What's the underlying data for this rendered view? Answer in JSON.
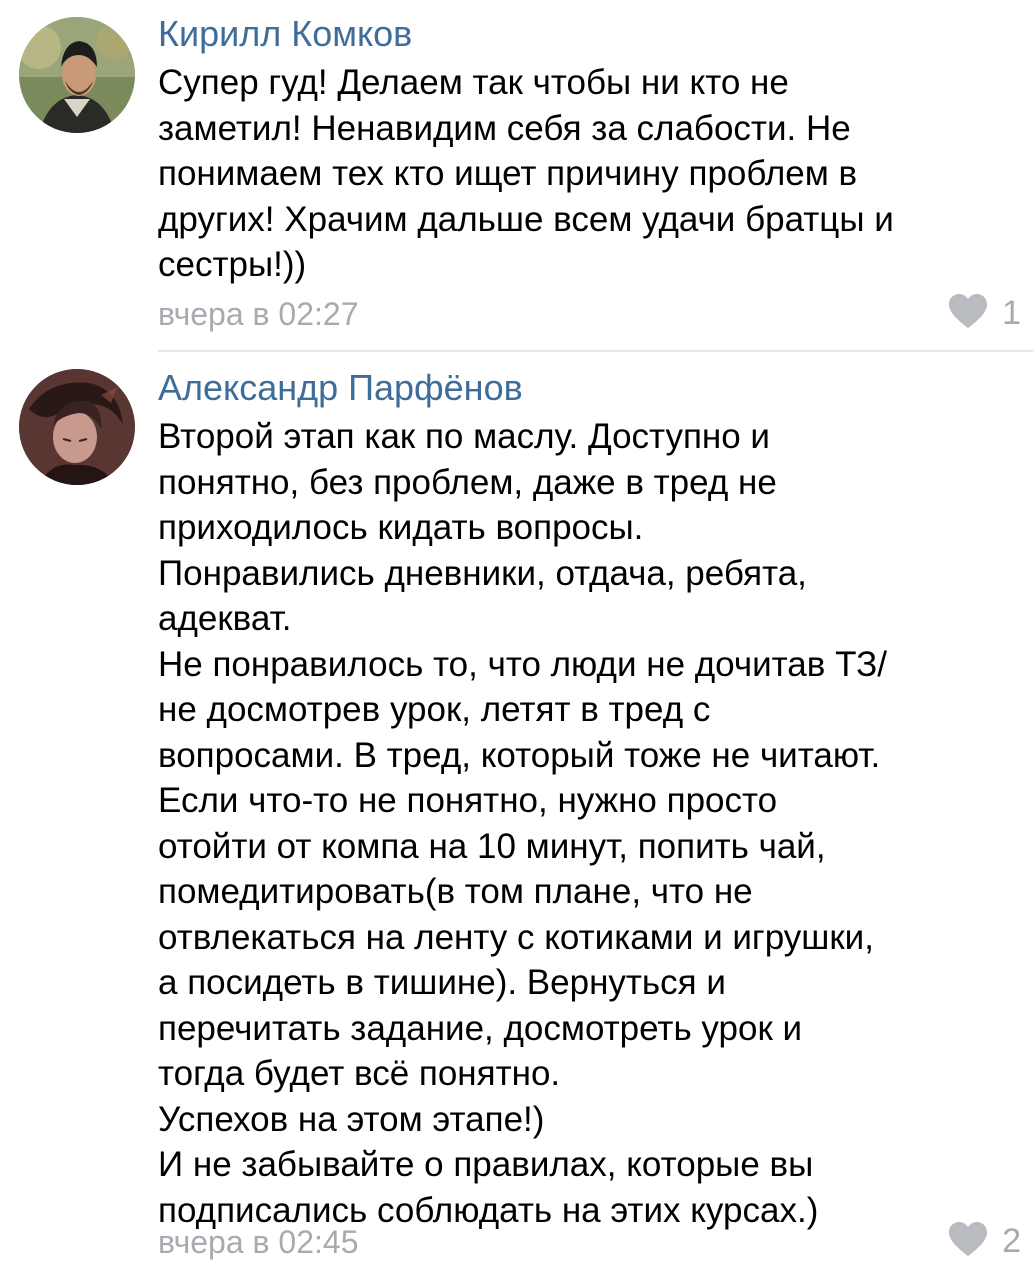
{
  "comments": [
    {
      "author": "Кирилл Комков",
      "lines": [
        "Супер гуд! Делаем так чтобы ни кто не",
        "заметил! Ненавидим себя за слабости. Не",
        "понимаем тех кто ищет причину проблем в",
        "других! Храчим дальше всем удачи братцы и",
        "сестры!))"
      ],
      "time": "вчера в 02:27",
      "likes": "1"
    },
    {
      "author": "Александр Парфёнов",
      "lines": [
        "Второй этап как по маслу. Доступно и",
        "понятно, без проблем, даже в тред не",
        "приходилось кидать вопросы.",
        "Понравились дневники, отдача, ребята,",
        "адекват.",
        "Не понравилось то, что люди не дочитав ТЗ/",
        "не досмотрев урок, летят в тред с",
        "вопросами. В тред, который тоже не читают.",
        "Если что-то не понятно, нужно просто",
        "отойти от компа на 10 минут, попить чай,",
        "помедитировать(в том плане, что не",
        "отвлекаться на ленту с котиками и игрушки,",
        "а посидеть в тишине). Вернуться и",
        "перечитать задание, досмотреть урок и",
        "тогда будет всё понятно.",
        "Успехов на этом этапе!)",
        "И не забывайте о правилах, которые вы",
        "подписались соблюдать на этих курсах.)"
      ],
      "time": "вчера в 02:45",
      "likes": "2"
    }
  ],
  "icons": {
    "like": "heart-icon",
    "like_color": "#b8bcc1"
  },
  "colors": {
    "author": "#3f6d9a",
    "meta": "#a7abb0"
  }
}
